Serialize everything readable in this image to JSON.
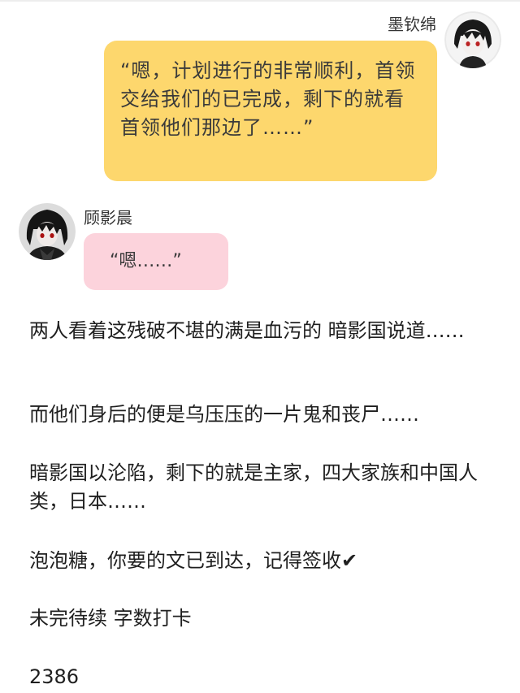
{
  "messages": [
    {
      "side": "right",
      "sender": "墨钦绵",
      "text": "“嗯，计划进行的非常顺利，首领交给我们的已完成，剩下的就看首领他们那边了……”",
      "bubble_color": "#fdd76d"
    },
    {
      "side": "left",
      "sender": "顾影晨",
      "text": "“嗯……”",
      "bubble_color": "#fcd3dc"
    }
  ],
  "paragraphs": [
    "两人看着这残破不堪的满是血污的 暗影国说道……",
    "而他们身后的便是乌压压的一片鬼和丧尸……",
    "暗影国以沦陷，剩下的就是主家，四大家族和中国人类，日本……",
    "泡泡糖，你要的文已到达，记得签收",
    "未完待续 字数打卡",
    "2386"
  ],
  "check_mark": "✔",
  "avatar_icon": "anime-avatar-icon"
}
